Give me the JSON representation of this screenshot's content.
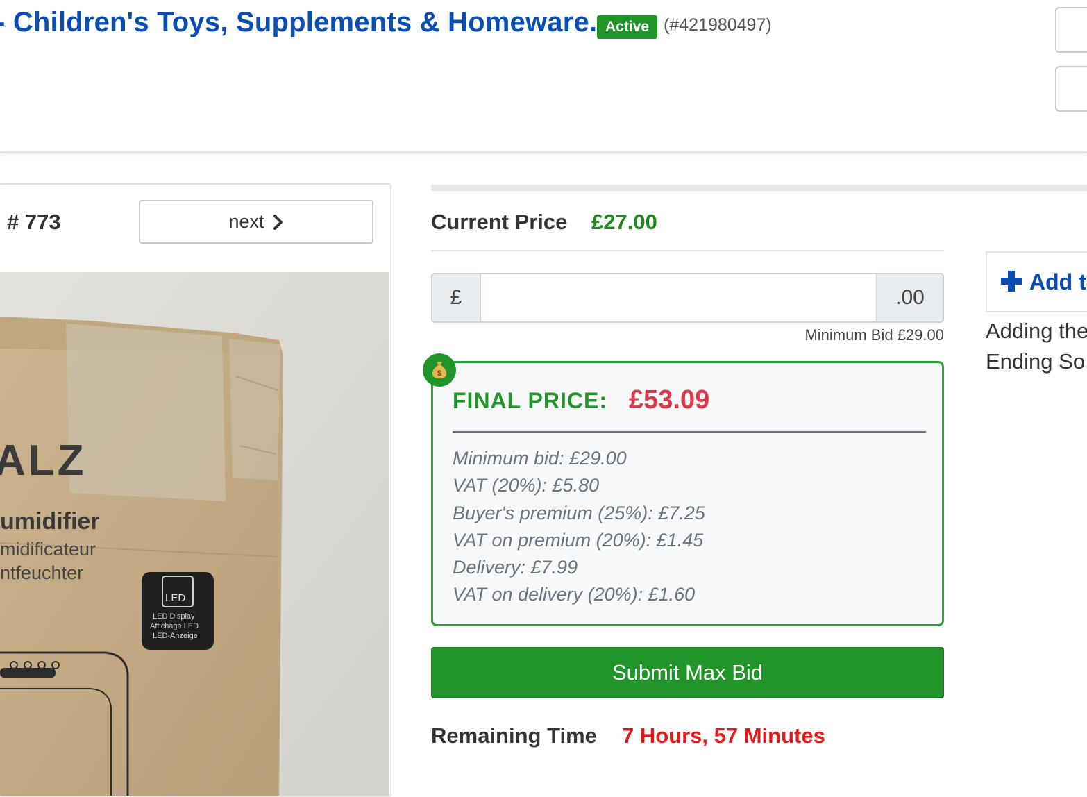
{
  "header": {
    "title": "- Children's Toys, Supplements & Homeware.",
    "status_badge": "Active",
    "auction_id": "(#421980497)"
  },
  "lot": {
    "number": "# 773",
    "next_label": "next",
    "photo_text": {
      "brand": "ALZ",
      "line1": "umidifier",
      "line2": "midificateur",
      "line3": "ntfeuchter",
      "led_badge_title": "LED",
      "led_badge_lines": [
        "LED Display",
        "Affichage LED",
        "LED-Anzeige"
      ]
    }
  },
  "bidding": {
    "current_price_label": "Current Price",
    "current_price": "£27.00",
    "currency_prefix": "£",
    "input_value": "",
    "cents_suffix": ".00",
    "minimum_bid_note": "Minimum Bid £29.00",
    "final_price_label": "FINAL PRICE:",
    "final_price": "£53.09",
    "breakdown": [
      "Minimum bid: £29.00",
      "VAT (20%): £5.80",
      "Buyer's premium (25%): £7.25",
      "VAT on premium (20%): £1.45",
      "Delivery: £7.99",
      "VAT on delivery (20%): £1.60"
    ],
    "submit_label": "Submit Max Bid",
    "remaining_label": "Remaining Time",
    "remaining_value": "7 Hours, 57 Minutes"
  },
  "watchlist": {
    "add_label": "Add t",
    "note_line1": "Adding the",
    "note_line2": "Ending So"
  },
  "colors": {
    "brand_blue": "#0a4db3",
    "success_green": "#22952a",
    "price_green": "#1e8a1e",
    "final_price_red": "#d83a4a",
    "remaining_red": "#e51b1b"
  },
  "icons": [
    "chevron-right-icon",
    "money-bag-icon",
    "plus-icon"
  ]
}
